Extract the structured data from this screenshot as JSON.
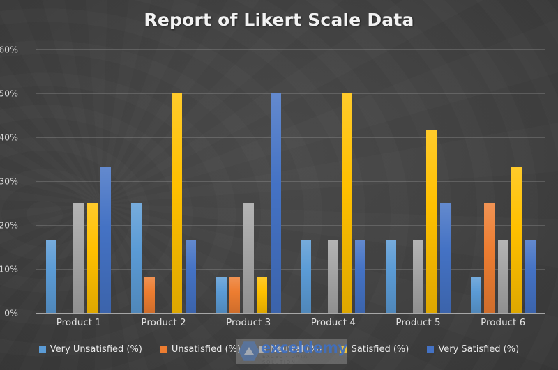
{
  "chart_data": {
    "type": "bar",
    "title": "Report of Likert Scale Data",
    "xlabel": "",
    "ylabel": "",
    "ylim": [
      0,
      60
    ],
    "ytick_labels": [
      "0%",
      "10%",
      "20%",
      "30%",
      "40%",
      "50%",
      "60%"
    ],
    "ytick_values": [
      0,
      10,
      20,
      30,
      40,
      50,
      60
    ],
    "grid": true,
    "legend_position": "bottom",
    "categories": [
      "Product 1",
      "Product 2",
      "Product 3",
      "Product 4",
      "Product 5",
      "Product 6"
    ],
    "series": [
      {
        "name": "Very Unsatisfied (%)",
        "color": "#5B9BD5",
        "values": [
          16.7,
          25.0,
          8.3,
          16.7,
          16.7,
          8.3
        ]
      },
      {
        "name": "Unsatisfied (%)",
        "color": "#ED7D31",
        "values": [
          0,
          8.3,
          8.3,
          0,
          0,
          25.0
        ]
      },
      {
        "name": "Neutral (%)",
        "color": "#A5A5A5",
        "values": [
          25.0,
          0,
          25.0,
          16.7,
          16.7,
          16.7
        ]
      },
      {
        "name": "Satisfied (%)",
        "color": "#FFC000",
        "values": [
          25.0,
          50.0,
          8.3,
          50.0,
          41.7,
          33.3
        ]
      },
      {
        "name": "Very Satisfied (%)",
        "color": "#4472C4",
        "values": [
          33.3,
          16.7,
          50.0,
          16.7,
          25.0,
          16.7
        ]
      }
    ]
  },
  "watermark": {
    "brand": "exceldemy",
    "tagline": "EXCEL · DATA · SOLUTION"
  }
}
